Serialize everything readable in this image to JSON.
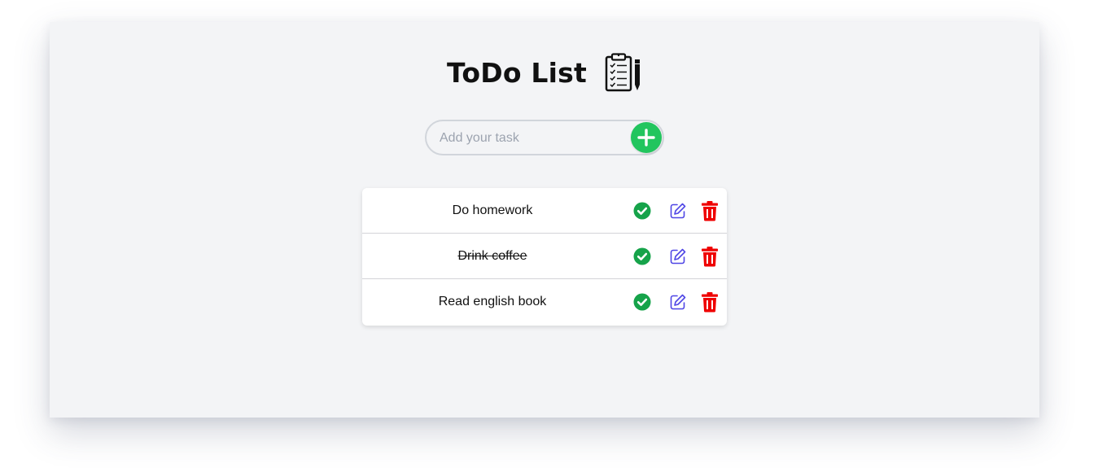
{
  "app": {
    "title": "ToDo List",
    "title_icon": "clipboard-checklist-icon"
  },
  "add_form": {
    "placeholder": "Add your task",
    "value": "",
    "add_icon": "plus-icon"
  },
  "tasks": [
    {
      "text": "Do homework",
      "completed": false
    },
    {
      "text": "Drink coffee",
      "completed": true
    },
    {
      "text": "Read english book",
      "completed": false
    }
  ],
  "colors": {
    "background": "#f3f4f6",
    "add_button": "#22c55e",
    "check": "#16a34a",
    "edit": "#4f46e5",
    "delete": "#ef0000"
  },
  "icons": {
    "complete": "check-circle-icon",
    "edit": "edit-icon",
    "delete": "trash-icon"
  }
}
